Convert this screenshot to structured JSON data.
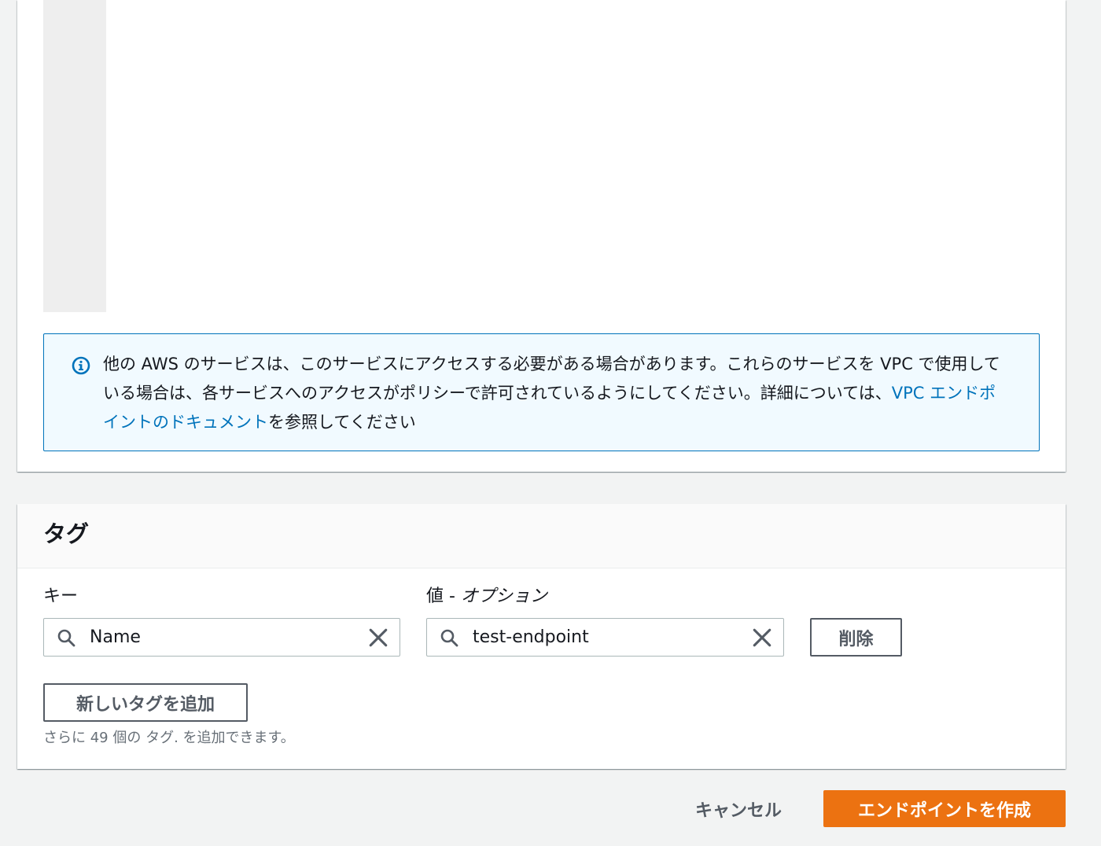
{
  "policy_panel": {
    "info": {
      "text_before": "他の AWS のサービスは、このサービスにアクセスする必要がある場合があります。これらのサービスを VPC で使用している場合は、各サービスへのアクセスがポリシーで許可されているようにしてください。詳細については、",
      "link_text": "VPC エンドポイントのドキュメント",
      "text_after": "を参照してください",
      "icon": "info-icon"
    }
  },
  "tags": {
    "title": "タグ",
    "key_label": "キー",
    "value_label": "値 - ",
    "value_label_optional": "オプション",
    "rows": [
      {
        "key": "Name",
        "value": "test-endpoint",
        "remove_label": "削除"
      }
    ],
    "add_button": "新しいタグを追加",
    "hint": "さらに 49 個の タグ. を追加できます。"
  },
  "footer": {
    "cancel_label": "キャンセル",
    "create_label": "エンドポイントを作成"
  },
  "colors": {
    "accent": "#ec7211",
    "link": "#0073bb",
    "info_bg": "#f1faff"
  }
}
